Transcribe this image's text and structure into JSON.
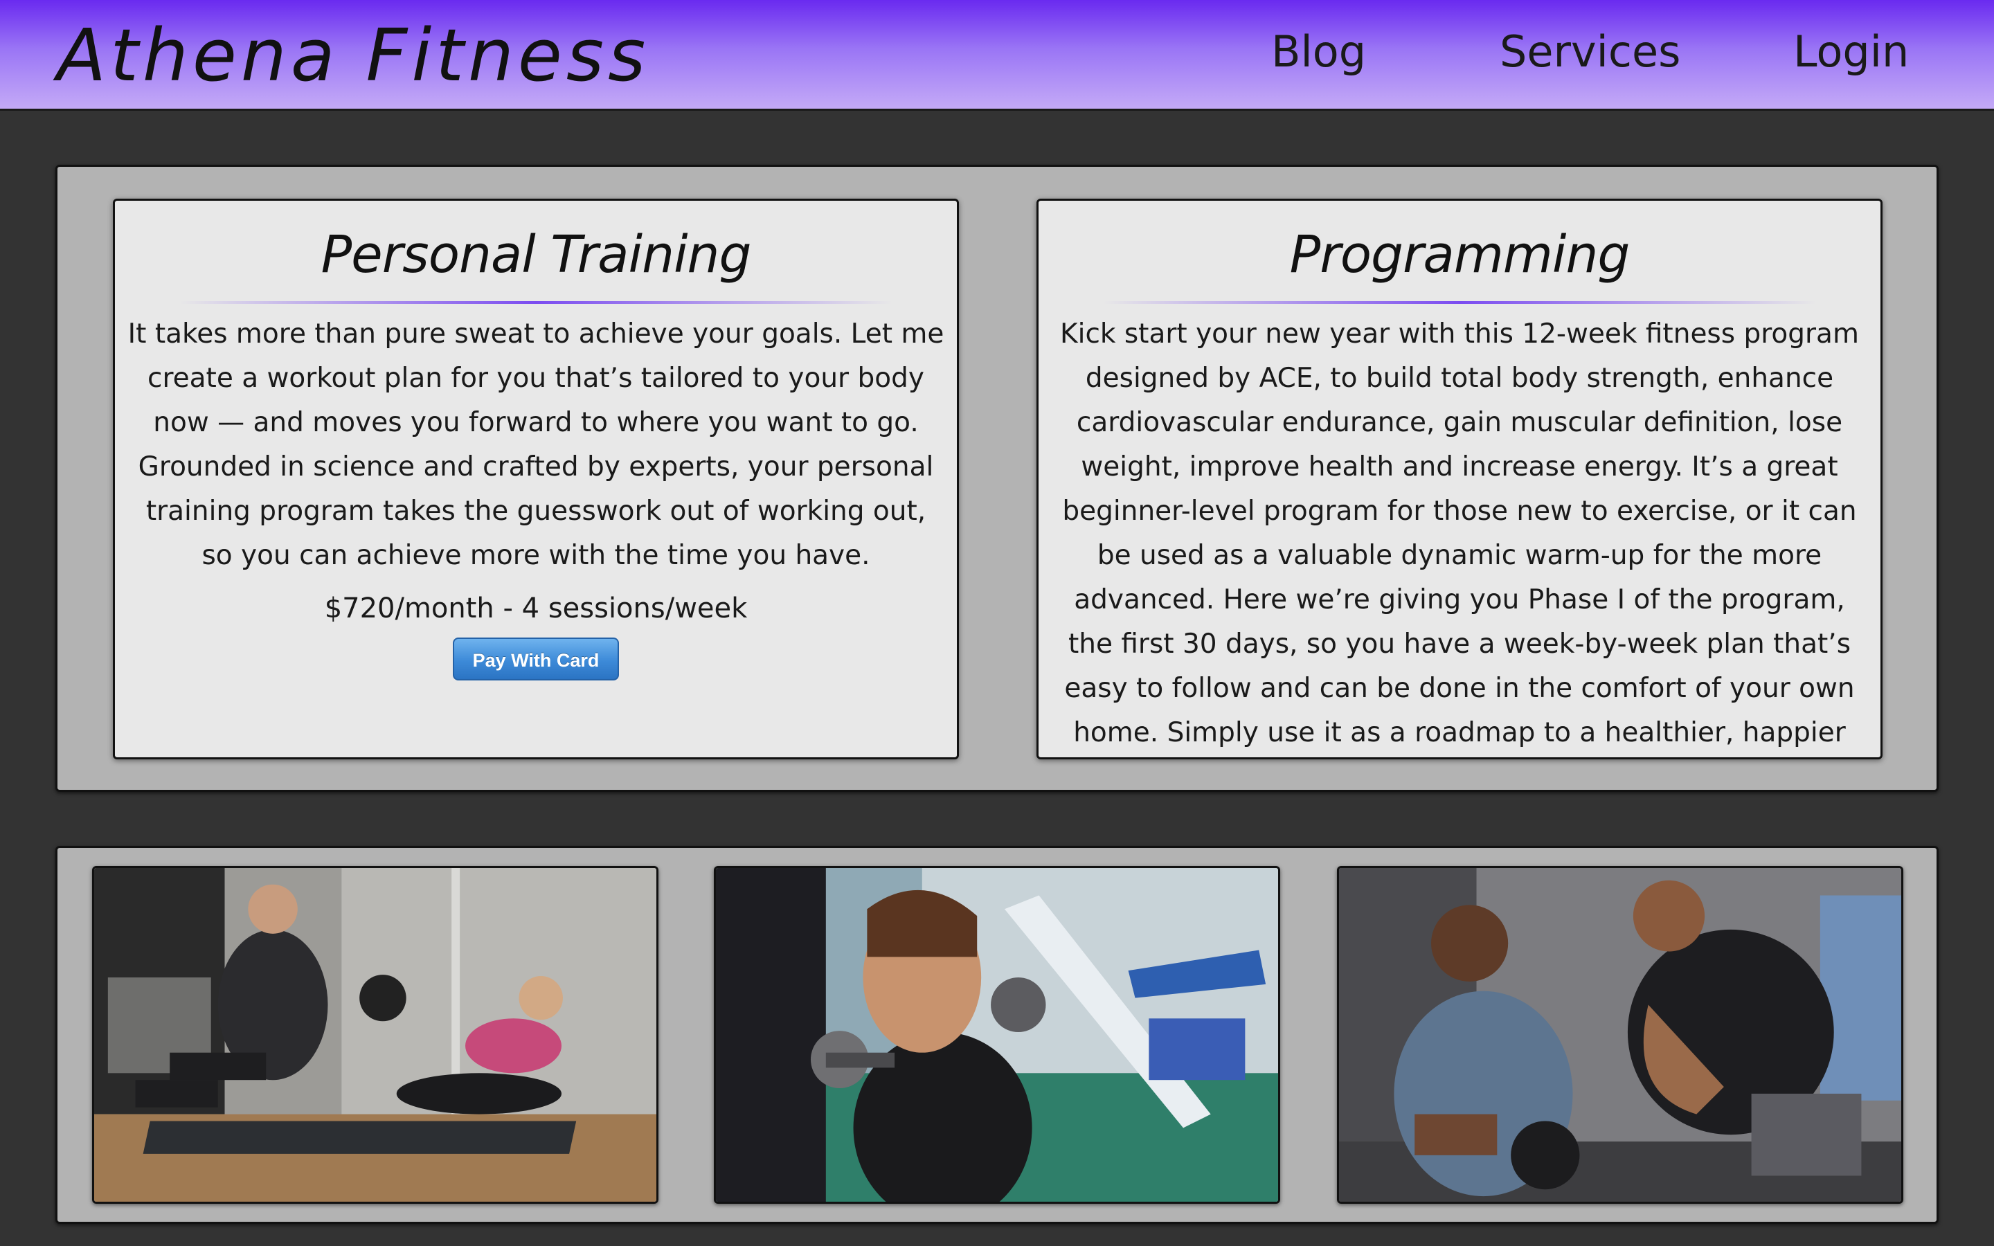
{
  "nav": {
    "brand": "Athena Fitness",
    "links": [
      {
        "label": "Blog"
      },
      {
        "label": "Services"
      },
      {
        "label": "Login"
      }
    ]
  },
  "services": {
    "personal_training": {
      "title": "Personal Training",
      "description": "It takes more than pure sweat to achieve your goals. Let me create a workout plan for you that’s tailored to your body now — and moves you forward to where you want to go. Grounded in science and crafted by experts, your personal training program takes the guesswork out of working out, so you can achieve more with the time you have.",
      "price": "$720/month - 4 sessions/week",
      "button_label": "Pay With Card"
    },
    "programming": {
      "title": "Programming",
      "description": "Kick start your new year with this 12-week fitness program designed by ACE, to build total body strength, enhance cardiovascular endurance, gain muscular definition, lose weight, improve health and increase energy. It’s a great beginner-level program for those new to exercise, or it can be used as a valuable dynamic warm-up for the more advanced. Here we’re giving you Phase I of the program, the first 30 days, so you have a week-by-week plan that’s easy to follow and can be done in the comfort of your own home. Simply use it as a roadmap to a healthier, happier you!"
    }
  },
  "theme": {
    "nav_gradient_top": "#6a2af0",
    "nav_gradient_bottom": "#c4aaf7",
    "page_background": "#333333",
    "panel_background": "#b3b3b3",
    "card_background": "#e8e8e8",
    "button_color": "#3d8ad8"
  }
}
